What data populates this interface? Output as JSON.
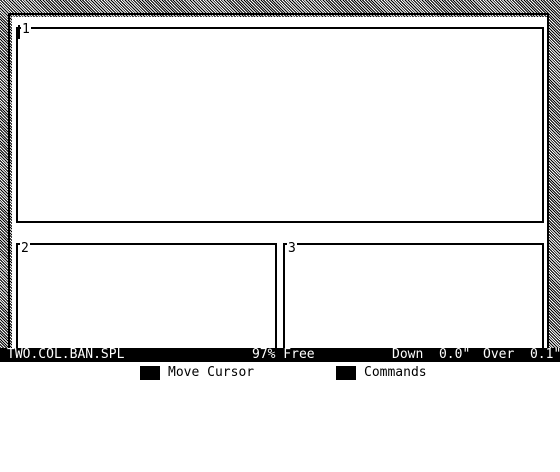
{
  "layout_panels": [
    {
      "number": "1"
    },
    {
      "number": "2"
    },
    {
      "number": "3"
    }
  ],
  "status": {
    "filename": "TWO.COL.BAN.SPL",
    "free": "97% Free",
    "down": "Down  0.0\"",
    "over": "Over  0.1\""
  },
  "help": {
    "move_key_icon": "open-apple-icon",
    "move_label": "Move Cursor",
    "commands_key_icon": "solid-apple-icon",
    "commands_label": "Commands"
  }
}
